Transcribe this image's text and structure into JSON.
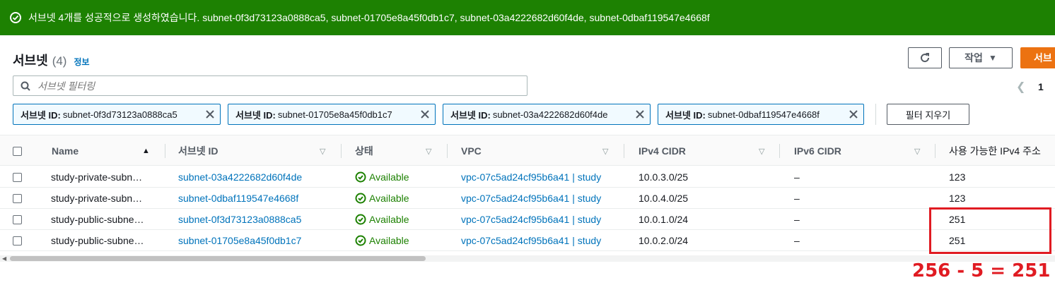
{
  "banner": {
    "message": "서브넷 4개를 성공적으로 생성하였습니다. subnet-0f3d73123a0888ca5, subnet-01705e8a45f0db1c7, subnet-03a4222682d60f4de, subnet-0dbaf119547e4668f"
  },
  "header": {
    "title": "서브넷",
    "count": "(4)",
    "info": "정보",
    "actions_label": "작업",
    "create_label": "서브"
  },
  "search": {
    "placeholder": "서브넷 필터링"
  },
  "pagination": {
    "page": "1"
  },
  "filters": [
    {
      "key": "서브넷 ID:",
      "value": "subnet-0f3d73123a0888ca5"
    },
    {
      "key": "서브넷 ID:",
      "value": "subnet-01705e8a45f0db1c7"
    },
    {
      "key": "서브넷 ID:",
      "value": "subnet-03a4222682d60f4de"
    },
    {
      "key": "서브넷 ID:",
      "value": "subnet-0dbaf119547e4668f"
    }
  ],
  "clear_filters_label": "필터 지우기",
  "table": {
    "columns": [
      "Name",
      "서브넷 ID",
      "상태",
      "VPC",
      "IPv4 CIDR",
      "IPv6 CIDR",
      "사용 가능한 IPv4 주소"
    ],
    "rows": [
      {
        "name": "study-private-subn…",
        "subnet_id": "subnet-03a4222682d60f4de",
        "state": "Available",
        "vpc": "vpc-07c5ad24cf95b6a41 | study",
        "ipv4": "10.0.3.0/25",
        "ipv6": "–",
        "available_ips": "123"
      },
      {
        "name": "study-private-subn…",
        "subnet_id": "subnet-0dbaf119547e4668f",
        "state": "Available",
        "vpc": "vpc-07c5ad24cf95b6a41 | study",
        "ipv4": "10.0.4.0/25",
        "ipv6": "–",
        "available_ips": "123"
      },
      {
        "name": "study-public-subne…",
        "subnet_id": "subnet-0f3d73123a0888ca5",
        "state": "Available",
        "vpc": "vpc-07c5ad24cf95b6a41 | study",
        "ipv4": "10.0.1.0/24",
        "ipv6": "–",
        "available_ips": "251"
      },
      {
        "name": "study-public-subne…",
        "subnet_id": "subnet-01705e8a45f0db1c7",
        "state": "Available",
        "vpc": "vpc-07c5ad24cf95b6a41 | study",
        "ipv4": "10.0.2.0/24",
        "ipv6": "–",
        "available_ips": "251"
      }
    ]
  },
  "annotation": {
    "text": "256 - 5 = 251"
  },
  "colors": {
    "success": "#1d8102",
    "link": "#0073bb",
    "primary": "#ec7211",
    "annotation": "#e01b22"
  }
}
